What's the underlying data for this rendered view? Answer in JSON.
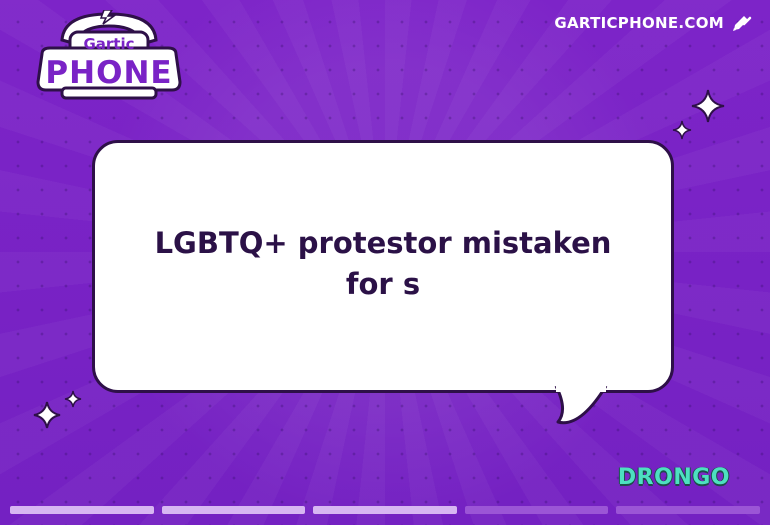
{
  "logo": {
    "top_word": "Gartic",
    "bottom_word": "PHONE"
  },
  "site": {
    "label": "GARTICPHONE.COM",
    "icon": "pen-icon"
  },
  "prompt": {
    "text": "LGBTQ+ protestor mistaken for s"
  },
  "author": {
    "name": "DRONGO"
  },
  "progress": {
    "segments": [
      {
        "state": "done"
      },
      {
        "state": "done"
      },
      {
        "state": "done"
      },
      {
        "state": "pending"
      },
      {
        "state": "pending"
      }
    ]
  },
  "colors": {
    "background": "#7a23c6",
    "bubble": "#ffffff",
    "text": "#2b1147",
    "author": "#4de0c0",
    "segment_done": "#d7b6f2",
    "segment_pending": "#9b55d6"
  }
}
